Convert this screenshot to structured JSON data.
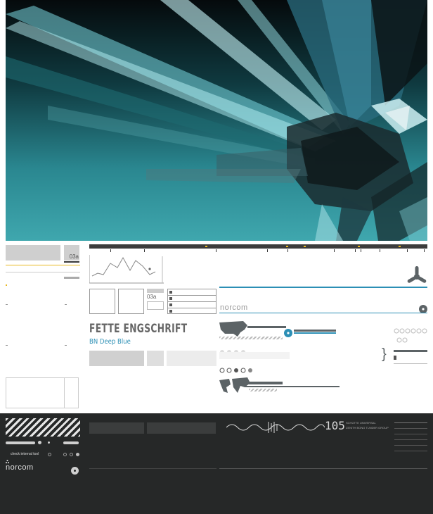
{
  "top_panel": {
    "label": "03a"
  },
  "mid_panel": {
    "label": "03a"
  },
  "brand": {
    "headline": "FETTE ENGSCHRIFT",
    "subline": "BN Deep Blue",
    "logo": "norcom",
    "logo_dark": "norcom"
  },
  "bottom_panel": {
    "number": "105",
    "caption_line1": "SCHÜTTE UNIVERSAL",
    "caption_line2": "ZENITH BONG TUNDER GROUP",
    "link_text": "check internal tool"
  },
  "colors": {
    "accent": "#2c8fb5",
    "marker": "#e8b820",
    "dark_bg": "#262828",
    "hero_teal": "#2a8b93"
  }
}
